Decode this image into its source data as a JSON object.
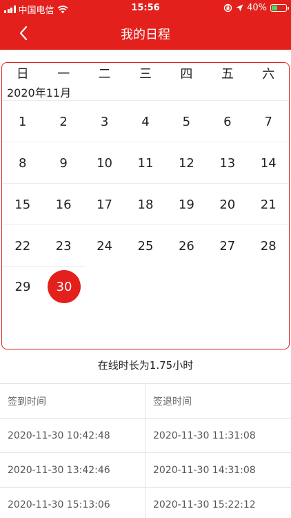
{
  "status_bar": {
    "carrier": "中国电信",
    "time": "15:56",
    "battery": "40%",
    "battery_level": 0.4
  },
  "nav": {
    "title": "我的日程",
    "back_icon": "chevron-left-icon"
  },
  "calendar": {
    "weekdays": [
      "日",
      "一",
      "二",
      "三",
      "四",
      "五",
      "六"
    ],
    "month": "2020年11月",
    "weeks": [
      [
        "1",
        "2",
        "3",
        "4",
        "5",
        "6",
        "7"
      ],
      [
        "8",
        "9",
        "10",
        "11",
        "12",
        "13",
        "14"
      ],
      [
        "15",
        "16",
        "17",
        "18",
        "19",
        "20",
        "21"
      ],
      [
        "22",
        "23",
        "24",
        "25",
        "26",
        "27",
        "28"
      ],
      [
        "29",
        "30"
      ]
    ],
    "selected": "30",
    "accent_color": "#e3201c"
  },
  "online_time": "在线时长为1.75小时",
  "attendance": {
    "headers": [
      "签到时间",
      "签退时间"
    ],
    "rows": [
      [
        "2020-11-30 10:42:48",
        "2020-11-30 11:31:08"
      ],
      [
        "2020-11-30 13:42:46",
        "2020-11-30 14:31:08"
      ],
      [
        "2020-11-30 15:13:06",
        "2020-11-30 15:22:12"
      ]
    ]
  }
}
